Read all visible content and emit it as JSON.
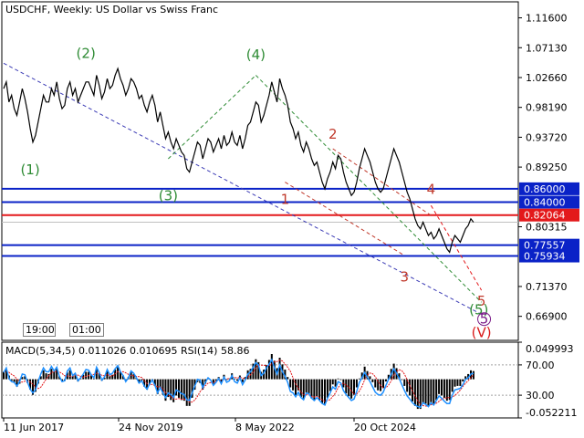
{
  "chart_data": {
    "type": "line",
    "title": "USDCHF, Weekly:  US Dollar vs Swiss Franc",
    "symbol": "USDCHF",
    "timeframe": "Weekly",
    "description": "US Dollar vs Swiss Franc",
    "ylim": [
      0.633,
      1.14
    ],
    "y_ticks": [
      1.116,
      1.0713,
      1.0266,
      0.9819,
      0.9372,
      0.8925,
      0.80315,
      0.7137,
      0.669
    ],
    "x_ticks": [
      "11 Jun 2017",
      "24 Nov 2019",
      "8 May 2022",
      "20 Oct 2024"
    ],
    "horizontal_levels": [
      {
        "value": 0.86,
        "label": "0.86000",
        "color": "#0a22c7"
      },
      {
        "value": 0.84,
        "label": "0.84000",
        "color": "#0a22c7"
      },
      {
        "value": 0.82064,
        "label": "0.82064",
        "color": "#e3191b"
      },
      {
        "value": 0.77557,
        "label": "0.77557",
        "color": "#0a22c7"
      },
      {
        "value": 0.75934,
        "label": "0.75934",
        "color": "#0a22c7"
      }
    ],
    "current_price": {
      "value": 0.81,
      "color": "#c0c0c0"
    },
    "price_series": [
      1.01,
      1.02,
      0.99,
      1.0,
      0.98,
      0.97,
      0.99,
      1.01,
      0.995,
      0.975,
      0.95,
      0.93,
      0.94,
      0.96,
      0.98,
      1.0,
      0.99,
      0.99,
      1.01,
      1.0,
      1.02,
      0.995,
      0.98,
      0.985,
      1.01,
      1.02,
      1.0,
      1.01,
      0.99,
      1.0,
      1.01,
      1.02,
      1.02,
      1.01,
      1.0,
      1.03,
      1.015,
      0.995,
      1.005,
      1.025,
      1.01,
      1.015,
      1.03,
      1.04,
      1.025,
      1.015,
      1.0,
      1.01,
      1.025,
      1.02,
      1.01,
      0.995,
      1.0,
      0.985,
      0.975,
      0.99,
      1.0,
      0.985,
      0.96,
      0.975,
      0.955,
      0.935,
      0.945,
      0.93,
      0.92,
      0.935,
      0.925,
      0.915,
      0.91,
      0.89,
      0.885,
      0.9,
      0.915,
      0.93,
      0.925,
      0.905,
      0.92,
      0.935,
      0.93,
      0.915,
      0.925,
      0.935,
      0.92,
      0.94,
      0.925,
      0.93,
      0.945,
      0.93,
      0.925,
      0.94,
      0.92,
      0.935,
      0.955,
      0.96,
      0.975,
      0.99,
      0.985,
      0.96,
      0.97,
      0.985,
      1.0,
      1.02,
      1.005,
      0.99,
      1.025,
      1.01,
      1.0,
      0.985,
      0.96,
      0.95,
      0.935,
      0.945,
      0.925,
      0.915,
      0.93,
      0.92,
      0.905,
      0.895,
      0.9,
      0.885,
      0.87,
      0.86,
      0.875,
      0.885,
      0.9,
      0.89,
      0.91,
      0.905,
      0.885,
      0.87,
      0.86,
      0.85,
      0.855,
      0.87,
      0.89,
      0.905,
      0.92,
      0.91,
      0.9,
      0.885,
      0.87,
      0.86,
      0.855,
      0.86,
      0.875,
      0.89,
      0.905,
      0.92,
      0.91,
      0.9,
      0.885,
      0.87,
      0.855,
      0.845,
      0.83,
      0.815,
      0.805,
      0.8,
      0.81,
      0.8,
      0.79,
      0.795,
      0.785,
      0.79,
      0.8,
      0.79,
      0.78,
      0.77,
      0.765,
      0.78,
      0.79,
      0.785,
      0.78,
      0.79,
      0.8,
      0.805,
      0.815,
      0.81
    ],
    "wave_labels": [
      {
        "text": "(1)",
        "value": 0.882,
        "color": "#2e8b34",
        "shape": "paren",
        "x_index": 10
      },
      {
        "text": "(2)",
        "value": 1.056,
        "color": "#2e8b34",
        "shape": "paren",
        "x_index": 31
      },
      {
        "text": "(3)",
        "value": 0.843,
        "color": "#2e8b34",
        "shape": "paren",
        "x_index": 62
      },
      {
        "text": "(4)",
        "value": 1.054,
        "color": "#2e8b34",
        "shape": "paren",
        "x_index": 95
      },
      {
        "text": "1",
        "value": 0.837,
        "color": "#c0392b",
        "shape": "plain",
        "x_index": 106
      },
      {
        "text": "2",
        "value": 0.935,
        "color": "#c0392b",
        "shape": "plain",
        "x_index": 124
      },
      {
        "text": "3",
        "value": 0.721,
        "color": "#c0392b",
        "shape": "plain",
        "x_index": 151
      },
      {
        "text": "4",
        "value": 0.852,
        "color": "#c0392b",
        "shape": "plain",
        "x_index": 161
      },
      {
        "text": "5",
        "value": 0.685,
        "color": "#c0392b",
        "shape": "plain",
        "x_index": 180
      },
      {
        "text": "(5)",
        "value": 0.672,
        "color": "#2e8b34",
        "shape": "paren",
        "x_index": 179
      },
      {
        "text": "5",
        "value": 0.658,
        "color": "#7a1b88",
        "shape": "circle",
        "x_index": 181
      },
      {
        "text": "(V)",
        "value": 0.638,
        "color": "#d91a1a",
        "shape": "paren",
        "x_index": 180
      }
    ],
    "indicator": {
      "label": "MACD(5,34,5) 0.011026 0.010695 RSI(14) 58.86",
      "ylim": [
        -0.052211,
        0.049993
      ],
      "y_ticks": [
        "0.049993",
        "70.00",
        "30.00",
        "-0.052211"
      ],
      "rsi_levels": [
        70,
        30
      ],
      "macd": [
        0.01,
        0.013,
        0.005,
        -0.002,
        -0.004,
        -0.01,
        -0.006,
        0.003,
        0.004,
        -0.005,
        -0.014,
        -0.021,
        -0.017,
        -0.006,
        0.004,
        0.012,
        0.008,
        0.007,
        0.014,
        0.01,
        0.014,
        0.004,
        -0.003,
        -0.002,
        0.009,
        0.012,
        0.004,
        0.006,
        -0.003,
        0.001,
        0.006,
        0.01,
        0.01,
        0.005,
        0.001,
        0.014,
        0.008,
        -0.002,
        0.002,
        0.011,
        0.004,
        0.006,
        0.013,
        0.017,
        0.01,
        0.005,
        -0.002,
        0.003,
        0.01,
        0.007,
        0.002,
        -0.005,
        -0.002,
        -0.01,
        -0.014,
        -0.007,
        -0.002,
        -0.009,
        -0.02,
        -0.013,
        -0.021,
        -0.029,
        -0.024,
        -0.028,
        -0.031,
        -0.022,
        -0.025,
        -0.028,
        -0.029,
        -0.036,
        -0.036,
        -0.025,
        -0.014,
        -0.004,
        -0.005,
        -0.014,
        -0.006,
        0.002,
        0.0,
        -0.007,
        -0.002,
        0.003,
        -0.004,
        0.006,
        -0.001,
        0.001,
        0.008,
        0.001,
        -0.002,
        0.005,
        -0.004,
        0.003,
        0.012,
        0.014,
        0.021,
        0.027,
        0.023,
        0.01,
        0.013,
        0.019,
        0.026,
        0.034,
        0.025,
        0.015,
        0.029,
        0.02,
        0.013,
        0.003,
        -0.011,
        -0.015,
        -0.022,
        -0.015,
        -0.024,
        -0.027,
        -0.018,
        -0.02,
        -0.026,
        -0.029,
        -0.023,
        -0.028,
        -0.033,
        -0.035,
        -0.025,
        -0.016,
        -0.007,
        -0.01,
        0.001,
        -0.001,
        -0.011,
        -0.019,
        -0.023,
        -0.026,
        -0.021,
        -0.011,
        0.001,
        0.009,
        0.017,
        0.011,
        0.004,
        -0.004,
        -0.011,
        -0.015,
        -0.016,
        -0.012,
        -0.003,
        0.006,
        0.014,
        0.021,
        0.015,
        0.008,
        -0.001,
        -0.009,
        -0.017,
        -0.022,
        -0.03,
        -0.036,
        -0.04,
        -0.04,
        -0.032,
        -0.033,
        -0.036,
        -0.031,
        -0.034,
        -0.028,
        -0.02,
        -0.022,
        -0.025,
        -0.029,
        -0.028,
        -0.017,
        -0.01,
        -0.009,
        -0.009,
        -0.003,
        0.004,
        0.007,
        0.012,
        0.011
      ],
      "rsi": [
        60,
        66,
        52,
        48,
        47,
        42,
        48,
        58,
        57,
        47,
        38,
        33,
        37,
        48,
        58,
        66,
        61,
        61,
        68,
        62,
        67,
        55,
        48,
        49,
        62,
        66,
        56,
        59,
        49,
        53,
        58,
        64,
        63,
        57,
        53,
        67,
        60,
        50,
        54,
        64,
        57,
        59,
        65,
        69,
        61,
        56,
        48,
        53,
        62,
        59,
        53,
        46,
        49,
        42,
        38,
        45,
        50,
        43,
        33,
        40,
        33,
        27,
        33,
        31,
        27,
        37,
        35,
        32,
        31,
        24,
        23,
        33,
        42,
        51,
        50,
        40,
        47,
        53,
        50,
        43,
        47,
        52,
        45,
        54,
        47,
        49,
        56,
        48,
        46,
        53,
        44,
        50,
        58,
        61,
        67,
        73,
        70,
        56,
        59,
        66,
        71,
        77,
        66,
        58,
        70,
        61,
        55,
        47,
        35,
        33,
        28,
        34,
        27,
        24,
        33,
        32,
        26,
        23,
        27,
        23,
        19,
        17,
        26,
        33,
        41,
        38,
        48,
        46,
        36,
        31,
        27,
        23,
        25,
        35,
        47,
        53,
        60,
        54,
        48,
        41,
        34,
        31,
        30,
        34,
        43,
        51,
        58,
        65,
        59,
        52,
        44,
        36,
        29,
        25,
        20,
        17,
        15,
        14,
        20,
        18,
        15,
        20,
        17,
        23,
        29,
        26,
        22,
        19,
        19,
        30,
        37,
        38,
        39,
        44,
        51,
        53,
        58,
        59
      ]
    }
  }
}
